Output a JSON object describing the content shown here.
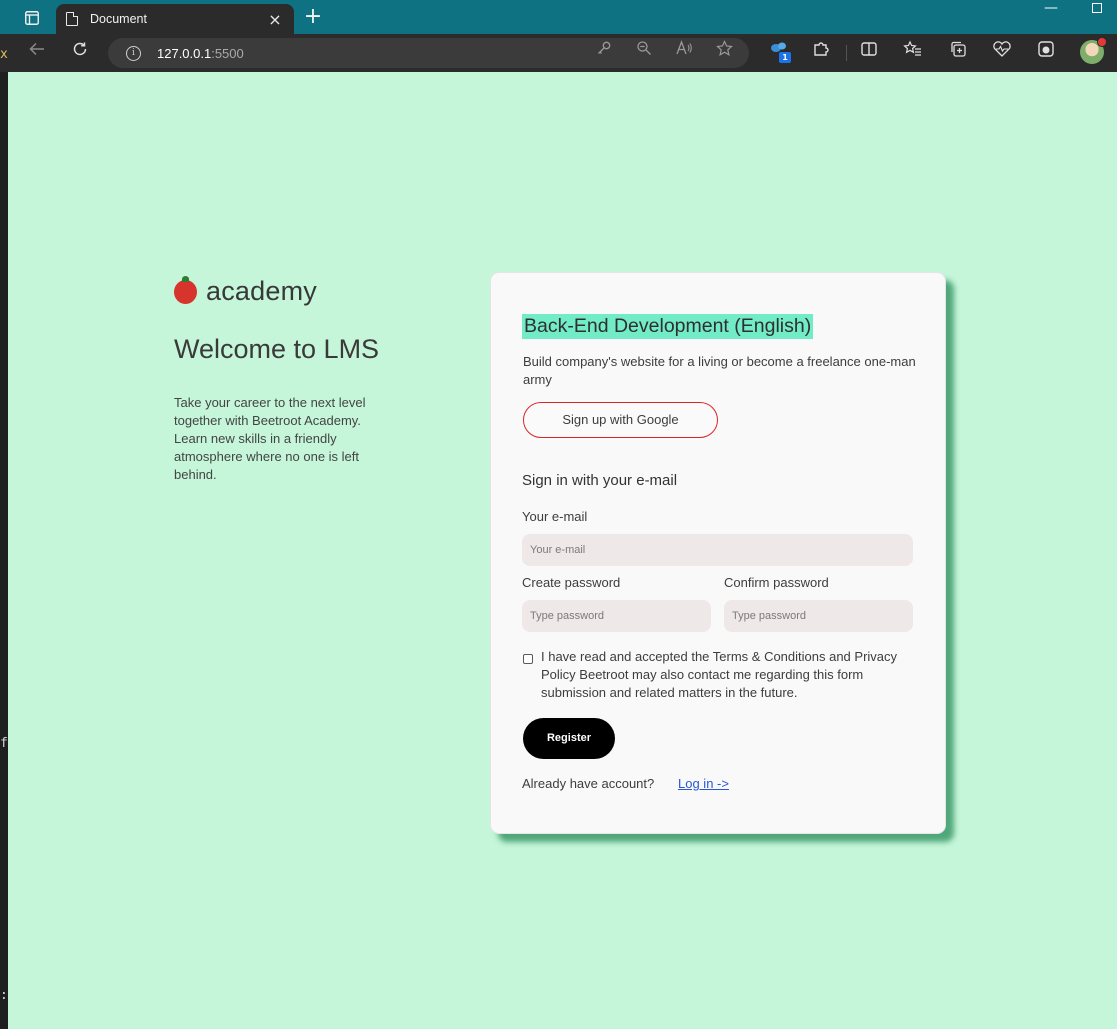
{
  "browser": {
    "tab_title": "Document",
    "tab_close": "×",
    "new_tab": "+",
    "url_host": "127.0.0.1",
    "url_port": ":5500",
    "extension_badge": "1"
  },
  "page": {
    "brand": "academy",
    "welcome": "Welcome to LMS",
    "intro": "Take your career to the next level together with Beetroot Academy. Learn new skills in a friendly atmosphere where no one is left behind.",
    "left_strip": [
      "x",
      "f",
      ":"
    ]
  },
  "card": {
    "course_title": "Back-End Development (English)",
    "course_desc": "Build company's website for a living or become a freelance one-man army",
    "google_button": "Sign up with Google",
    "signin_title": "Sign in with your e-mail",
    "email_label": "Your e-mail",
    "email_placeholder": "Your e-mail",
    "create_password_label": "Create password",
    "create_password_placeholder": "Type password",
    "confirm_password_label": "Confirm password",
    "confirm_password_placeholder": "Type password",
    "terms_text": "I have read and accepted the Terms & Conditions and Privacy Policy Beetroot may also contact me regarding this form submission and related matters in the future.",
    "register_button": "Register",
    "account_text": "Already have account?",
    "login_link": "Log in ->"
  },
  "colors": {
    "page_bg": "#c5f6d9",
    "title_highlight": "#71ecc7",
    "google_border": "#d9252a",
    "link": "#2a56d6",
    "chrome_tab_bar": "#0e7282"
  }
}
